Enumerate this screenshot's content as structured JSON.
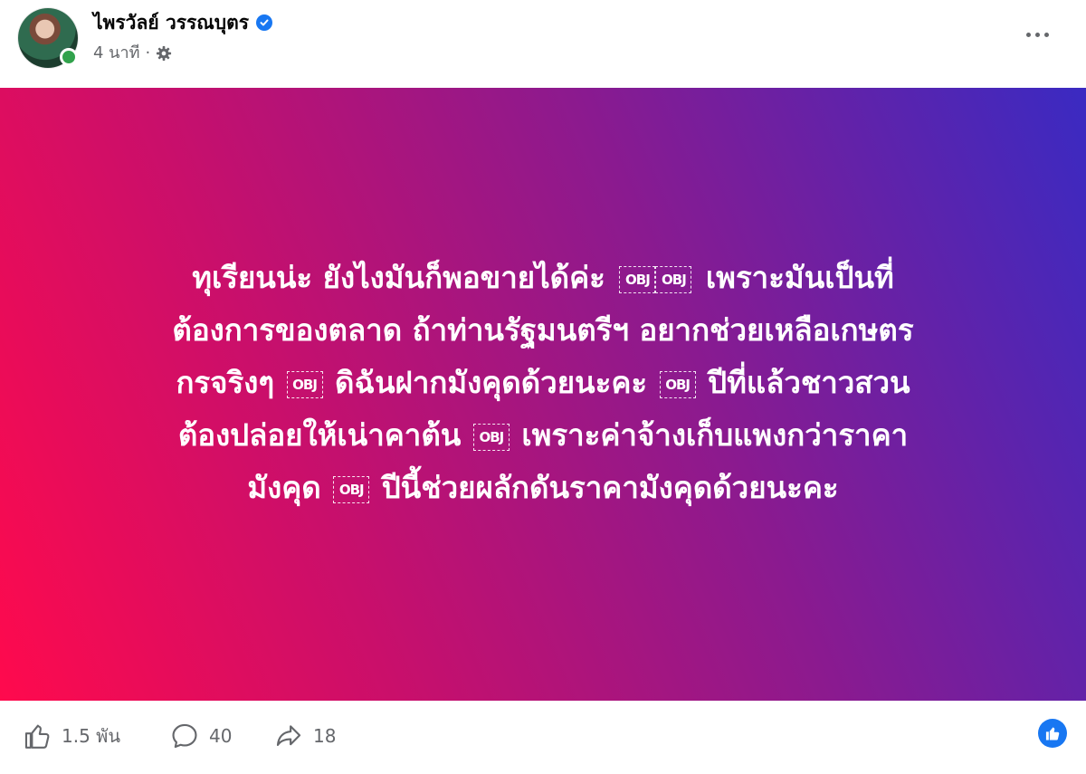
{
  "author": {
    "name": "ไพรวัลย์ วรรณบุตร",
    "verified": true,
    "online": true
  },
  "meta": {
    "time": "4 นาที",
    "separator": "·",
    "privacy_icon": "settings-gear-icon"
  },
  "post": {
    "background_gradient": [
      "#ff0a4d",
      "#c90f6b",
      "#8b1a8f",
      "#3a2ac2"
    ],
    "text_color": "#ffffff",
    "placeholder_glyph": "OBJ",
    "lines": [
      {
        "a": "ทุเรียนน่ะ ยังไงมันก็พอขายได้ค่ะ",
        "b": "เพราะมันเป็นที่"
      },
      {
        "a": "ต้องการของตลาด ถ้าท่านรัฐมนตรีฯ อยากช่วยเหลือเกษตร"
      },
      {
        "a": "กรจริงๆ",
        "b": "ดิฉันฝากมังคุดด้วยนะคะ",
        "c": "ปีที่แล้วชาวสวน"
      },
      {
        "a": "ต้องปล่อยให้เน่าคาต้น",
        "b": "เพราะค่าจ้างเก็บแพงกว่าราคา"
      },
      {
        "a": "มังคุด",
        "b": "ปีนี้ช่วยผลักดันราคามังคุดด้วยนะคะ"
      }
    ]
  },
  "footer": {
    "likes": "1.5 พัน",
    "comments": "40",
    "shares": "18",
    "accent_color": "#1877f2"
  }
}
